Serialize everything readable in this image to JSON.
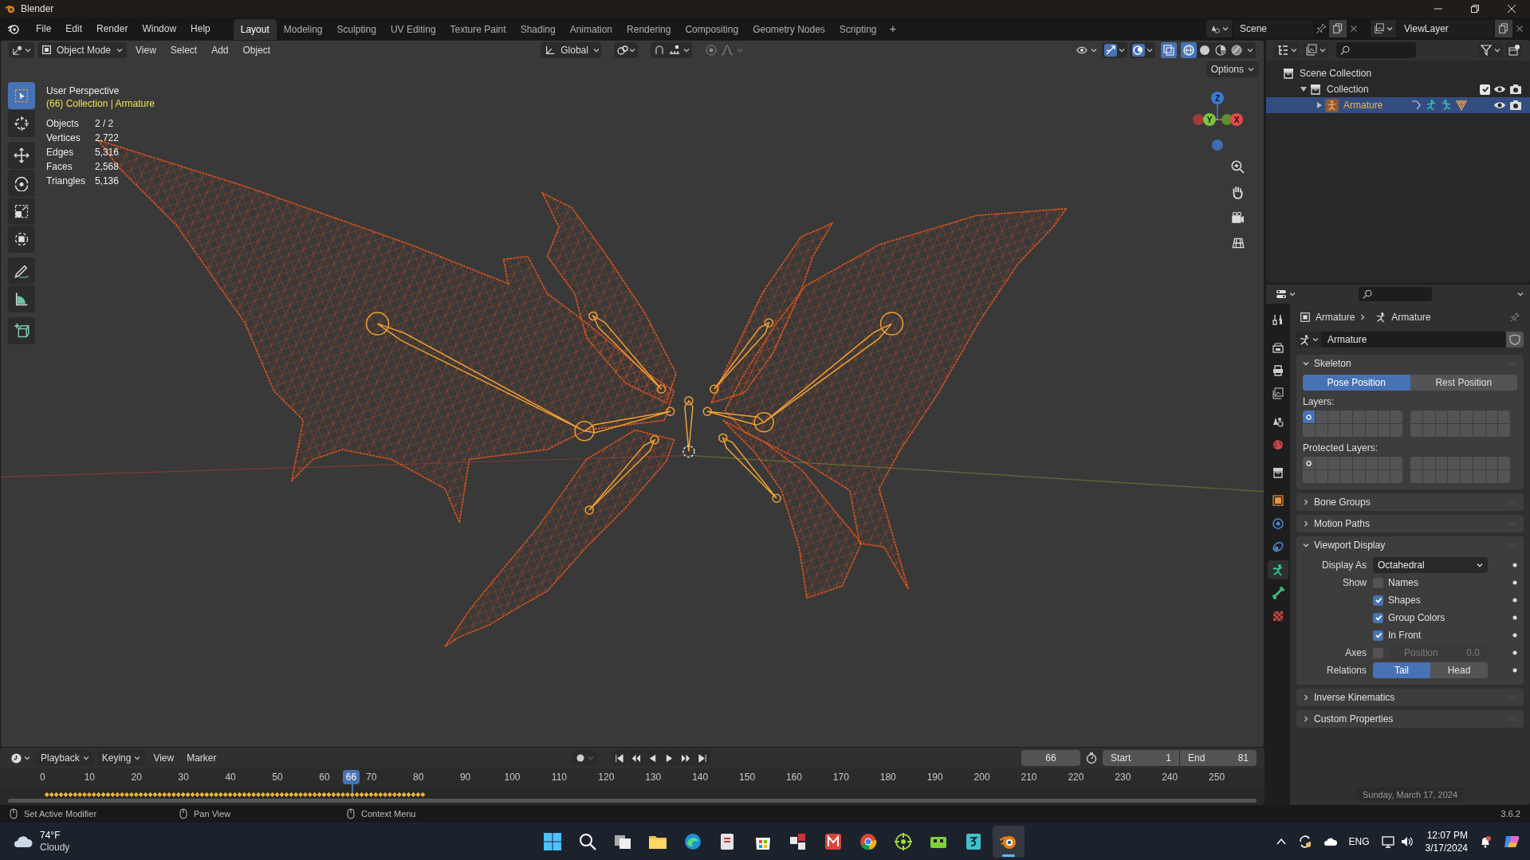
{
  "window": {
    "title": "Blender"
  },
  "menus": [
    "File",
    "Edit",
    "Render",
    "Window",
    "Help"
  ],
  "workspaces": [
    {
      "label": "Layout",
      "selected": true
    },
    {
      "label": "Modeling",
      "selected": false
    },
    {
      "label": "Sculpting",
      "selected": false
    },
    {
      "label": "UV Editing",
      "selected": false
    },
    {
      "label": "Texture Paint",
      "selected": false
    },
    {
      "label": "Shading",
      "selected": false
    },
    {
      "label": "Animation",
      "selected": false
    },
    {
      "label": "Rendering",
      "selected": false
    },
    {
      "label": "Compositing",
      "selected": false
    },
    {
      "label": "Geometry Nodes",
      "selected": false
    },
    {
      "label": "Scripting",
      "selected": false
    }
  ],
  "add_workspace": "+",
  "scene": "Scene",
  "view_layer": "ViewLayer",
  "viewport": {
    "mode": "Object Mode",
    "menus": [
      "View",
      "Select",
      "Add",
      "Object"
    ],
    "orientation": "Global",
    "options": "Options",
    "shading": [
      {
        "selected": true
      },
      {
        "selected": false
      },
      {
        "selected": false
      },
      {
        "selected": false
      }
    ],
    "view_name": "User Perspective",
    "context": "(66) Collection | Armature",
    "stats": [
      {
        "label": "Objects",
        "value": "2 / 2"
      },
      {
        "label": "Vertices",
        "value": "2,722"
      },
      {
        "label": "Edges",
        "value": "5,316"
      },
      {
        "label": "Faces",
        "value": "2,568"
      },
      {
        "label": "Triangles",
        "value": "5,136"
      }
    ],
    "tools": [
      {
        "selected": true
      },
      {
        "selected": false
      },
      {
        "selected": false
      },
      {
        "selected": false
      },
      {
        "selected": false
      },
      {
        "selected": false
      },
      {
        "selected": false
      },
      {
        "selected": false
      },
      {
        "selected": false
      }
    ],
    "gizmo_axes": [
      "Z",
      "Y",
      "X"
    ]
  },
  "outliner": {
    "items": [
      {
        "label": "Scene Collection",
        "selected": false,
        "children": [
          {
            "label": "Collection",
            "selected": false,
            "expanded": true,
            "checked": true,
            "children": [
              {
                "label": "Armature",
                "selected": true,
                "expanded": false
              }
            ]
          }
        ]
      }
    ]
  },
  "properties": {
    "tabs": [
      {
        "selected": false
      },
      {
        "selected": false
      },
      {
        "selected": false
      },
      {
        "selected": false
      },
      {
        "selected": false
      },
      {
        "selected": false
      },
      {
        "selected": false
      },
      {
        "selected": false
      },
      {
        "selected": false
      },
      {
        "selected": false
      },
      {
        "selected": true
      },
      {
        "selected": false
      },
      {
        "selected": false
      }
    ],
    "breadcrumb": [
      "Armature",
      "Armature"
    ],
    "data_name": "Armature",
    "panels": [
      {
        "kind": "skeleton",
        "title": "Skeleton",
        "expanded": true,
        "positions": [
          {
            "label": "Pose Position",
            "selected": true
          },
          {
            "label": "Rest Position",
            "selected": false
          }
        ],
        "layers_label": "Layers:",
        "layers": [
          {
            "selected": true,
            "used": true
          },
          {
            "selected": false,
            "used": false
          },
          {
            "selected": false,
            "used": false
          },
          {
            "selected": false,
            "used": false
          },
          {
            "selected": false,
            "used": false
          },
          {
            "selected": false,
            "used": false
          },
          {
            "selected": false,
            "used": false
          },
          {
            "selected": false,
            "used": false
          },
          {
            "selected": false,
            "used": false
          },
          {
            "selected": false,
            "used": false
          },
          {
            "selected": false,
            "used": false
          },
          {
            "selected": false,
            "used": false
          },
          {
            "selected": false,
            "used": false
          },
          {
            "selected": false,
            "used": false
          },
          {
            "selected": false,
            "used": false
          },
          {
            "selected": false,
            "used": false
          },
          {
            "selected": false,
            "used": false
          },
          {
            "selected": false,
            "used": false
          },
          {
            "selected": false,
            "used": false
          },
          {
            "selected": false,
            "used": false
          },
          {
            "selected": false,
            "used": false
          },
          {
            "selected": false,
            "used": false
          },
          {
            "selected": false,
            "used": false
          },
          {
            "selected": false,
            "used": false
          },
          {
            "selected": false,
            "used": false
          },
          {
            "selected": false,
            "used": false
          },
          {
            "selected": false,
            "used": false
          },
          {
            "selected": false,
            "used": false
          },
          {
            "selected": false,
            "used": false
          },
          {
            "selected": false,
            "used": false
          },
          {
            "selected": false,
            "used": false
          },
          {
            "selected": false,
            "used": false
          }
        ],
        "protected_label": "Protected Layers:",
        "protected_layers": [
          {
            "selected": false,
            "used": true
          },
          {
            "selected": false,
            "used": false
          },
          {
            "selected": false,
            "used": false
          },
          {
            "selected": false,
            "used": false
          },
          {
            "selected": false,
            "used": false
          },
          {
            "selected": false,
            "used": false
          },
          {
            "selected": false,
            "used": false
          },
          {
            "selected": false,
            "used": false
          },
          {
            "selected": false,
            "used": false
          },
          {
            "selected": false,
            "used": false
          },
          {
            "selected": false,
            "used": false
          },
          {
            "selected": false,
            "used": false
          },
          {
            "selected": false,
            "used": false
          },
          {
            "selected": false,
            "used": false
          },
          {
            "selected": false,
            "used": false
          },
          {
            "selected": false,
            "used": false
          },
          {
            "selected": false,
            "used": false
          },
          {
            "selected": false,
            "used": false
          },
          {
            "selected": false,
            "used": false
          },
          {
            "selected": false,
            "used": false
          },
          {
            "selected": false,
            "used": false
          },
          {
            "selected": false,
            "used": false
          },
          {
            "selected": false,
            "used": false
          },
          {
            "selected": false,
            "used": false
          },
          {
            "selected": false,
            "used": false
          },
          {
            "selected": false,
            "used": false
          },
          {
            "selected": false,
            "used": false
          },
          {
            "selected": false,
            "used": false
          },
          {
            "selected": false,
            "used": false
          },
          {
            "selected": false,
            "used": false
          },
          {
            "selected": false,
            "used": false
          },
          {
            "selected": false,
            "used": false
          }
        ]
      },
      {
        "kind": "collapsed",
        "title": "Bone Groups",
        "expanded": false
      },
      {
        "kind": "collapsed",
        "title": "Motion Paths",
        "expanded": false
      },
      {
        "kind": "viewport_display",
        "title": "Viewport Display",
        "expanded": true,
        "rows": [
          {
            "kind": "dropdown",
            "label": "Display As",
            "value": "Octahedral"
          },
          {
            "kind": "checkbox",
            "label": "Show",
            "text": "Names",
            "checked": false
          },
          {
            "kind": "checkbox",
            "text": "Shapes",
            "checked": true
          },
          {
            "kind": "checkbox",
            "text": "Group Colors",
            "checked": true
          },
          {
            "kind": "checkbox",
            "text": "In Front",
            "checked": true
          },
          {
            "kind": "axes",
            "label": "Axes",
            "checked": false,
            "field_label": "Position",
            "field_value": "0.0",
            "disabled": true
          },
          {
            "kind": "toggle",
            "label": "Relations",
            "options": [
              {
                "label": "Tail",
                "selected": true
              },
              {
                "label": "Head",
                "selected": false
              }
            ]
          }
        ]
      },
      {
        "kind": "collapsed",
        "title": "Inverse Kinematics",
        "expanded": false
      },
      {
        "kind": "collapsed",
        "title": "Custom Properties",
        "expanded": false
      }
    ],
    "date_tooltip": "Sunday, March 17, 2024"
  },
  "timeline": {
    "menus": [
      "Playback",
      "Keying",
      "View",
      "Marker"
    ],
    "current_frame": "66",
    "start_label": "Start",
    "start": "1",
    "end_label": "End",
    "end": "81",
    "ticks": [
      "0",
      "10",
      "20",
      "30",
      "40",
      "50",
      "60",
      "70",
      "80",
      "90",
      "100",
      "110",
      "120",
      "130",
      "140",
      "150",
      "160",
      "170",
      "180",
      "190",
      "200",
      "210",
      "220",
      "230",
      "240",
      "250"
    ],
    "playhead": "66"
  },
  "status_bar": {
    "hints": [
      "Set Active Modifier",
      "Pan View",
      "Context Menu"
    ],
    "version": "3.6.2"
  },
  "taskbar": {
    "weather": {
      "temperature": "74°F",
      "condition": "Cloudy"
    },
    "apps": [
      {
        "selected": false
      },
      {
        "selected": false
      },
      {
        "selected": false
      },
      {
        "selected": false
      },
      {
        "selected": false
      },
      {
        "selected": false
      },
      {
        "selected": false
      },
      {
        "selected": false
      },
      {
        "selected": false
      },
      {
        "selected": false
      },
      {
        "selected": false
      },
      {
        "selected": false
      },
      {
        "selected": false
      },
      {
        "selected": true
      }
    ],
    "language": "ENG",
    "time": "12:07 PM",
    "date": "3/17/2024"
  }
}
